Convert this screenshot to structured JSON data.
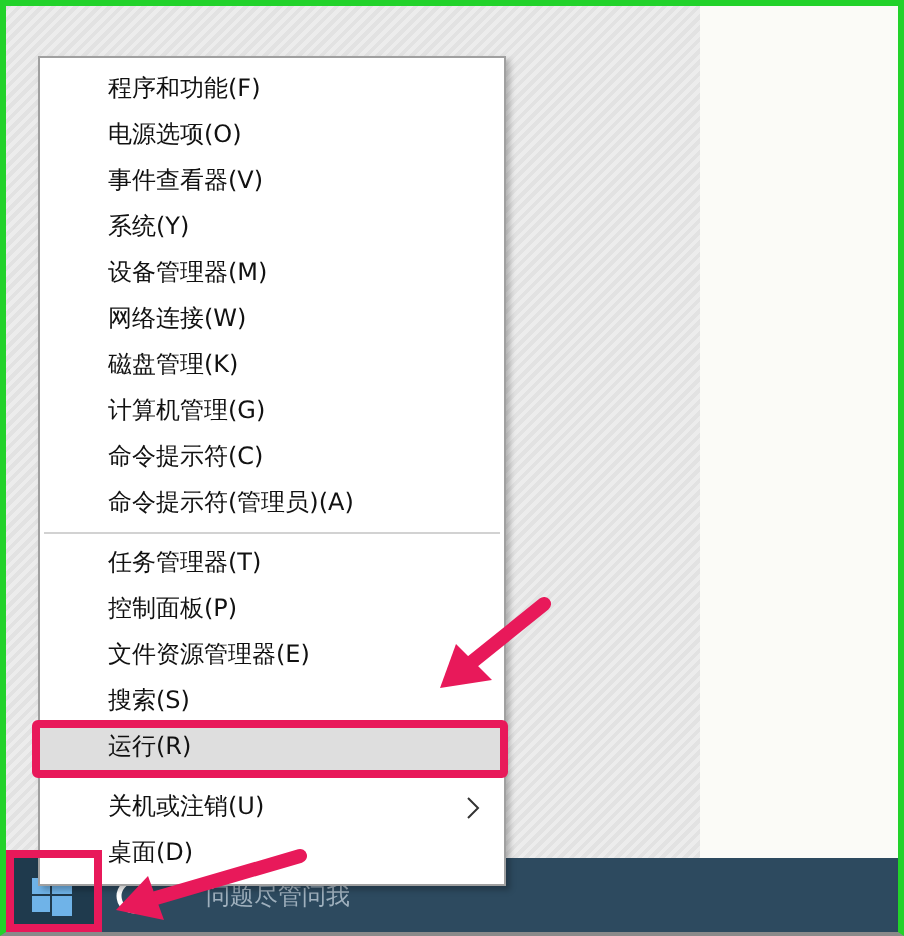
{
  "menu": {
    "groups": [
      {
        "items": [
          {
            "label": "程序和功能(F)",
            "selected": false,
            "submenu": false
          },
          {
            "label": "电源选项(O)",
            "selected": false,
            "submenu": false
          },
          {
            "label": "事件查看器(V)",
            "selected": false,
            "submenu": false
          },
          {
            "label": "系统(Y)",
            "selected": false,
            "submenu": false
          },
          {
            "label": "设备管理器(M)",
            "selected": false,
            "submenu": false
          },
          {
            "label": "网络连接(W)",
            "selected": false,
            "submenu": false
          },
          {
            "label": "磁盘管理(K)",
            "selected": false,
            "submenu": false
          },
          {
            "label": "计算机管理(G)",
            "selected": false,
            "submenu": false
          },
          {
            "label": "命令提示符(C)",
            "selected": false,
            "submenu": false
          },
          {
            "label": "命令提示符(管理员)(A)",
            "selected": false,
            "submenu": false
          }
        ]
      },
      {
        "items": [
          {
            "label": "任务管理器(T)",
            "selected": false,
            "submenu": false
          },
          {
            "label": "控制面板(P)",
            "selected": false,
            "submenu": false
          },
          {
            "label": "文件资源管理器(E)",
            "selected": false,
            "submenu": false
          },
          {
            "label": "搜索(S)",
            "selected": false,
            "submenu": false
          },
          {
            "label": "运行(R)",
            "selected": true,
            "submenu": false
          }
        ]
      },
      {
        "items": [
          {
            "label": "关机或注销(U)",
            "selected": false,
            "submenu": true
          },
          {
            "label": "桌面(D)",
            "selected": false,
            "submenu": false
          }
        ]
      }
    ]
  },
  "taskbar": {
    "search": {
      "placeholder": "问题尽管问我"
    }
  }
}
